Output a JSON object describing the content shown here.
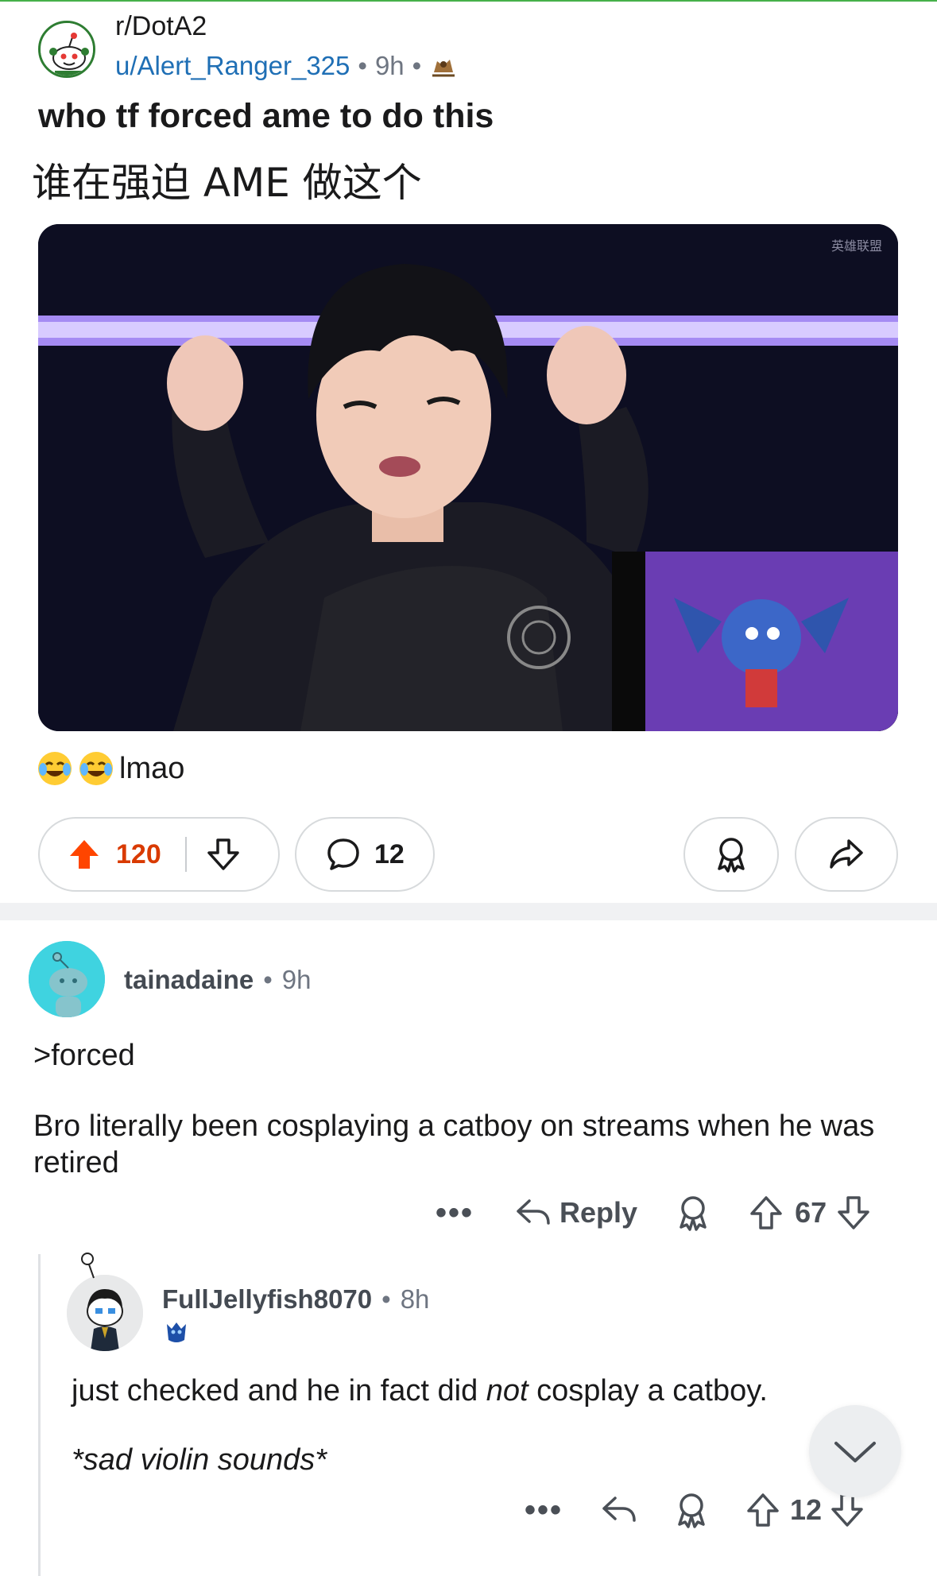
{
  "post": {
    "subreddit": "r/DotA2",
    "author": "u/Alert_Ranger_325",
    "time": "9h",
    "separator": "•",
    "title": "who tf forced ame to do this",
    "title_cn": "谁在强迫 AME 做这个",
    "media_watermark": "英雄联盟",
    "flair_text": "lmao",
    "score": "120",
    "comments": "12"
  },
  "comments": [
    {
      "author": "tainadaine",
      "time": "9h",
      "lines": [
        ">forced",
        "Bro literally been cosplaying a catboy on streams when he was retired"
      ],
      "reply_label": "Reply",
      "score": "67",
      "more": "•••"
    },
    {
      "author": "FullJellyfish8070",
      "time": "8h",
      "line1_before": "just checked and he in fact did ",
      "line1_em": "not",
      "line1_after": " cosplay a catboy.",
      "line2": "*sad violin sounds*",
      "score": "12",
      "more": "•••"
    }
  ],
  "colors": {
    "upvote_active": "#ff4500",
    "score_active": "#d93a00",
    "link_blue": "#1f6fb5",
    "muted": "#6e7581"
  },
  "icons": [
    "snoo-avatar-icon",
    "upvote-icon",
    "downvote-icon",
    "comment-icon",
    "award-icon",
    "share-icon",
    "reply-icon",
    "chevron-down-icon"
  ]
}
